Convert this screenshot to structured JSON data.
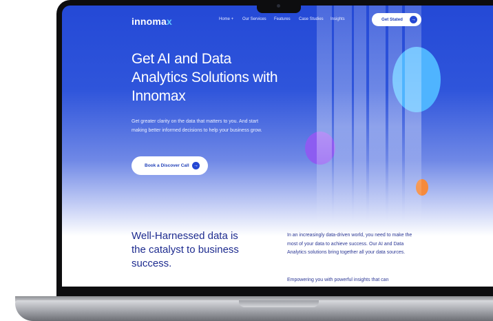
{
  "brand": {
    "logo_main": "innoma",
    "logo_accent": "x"
  },
  "nav": {
    "items": [
      {
        "label": "Home +"
      },
      {
        "label": "Our Services"
      },
      {
        "label": "Features"
      },
      {
        "label": "Case Studies"
      },
      {
        "label": "Insights"
      }
    ],
    "cta_label": "Get Stated",
    "cta_icon": "arrow-right-icon"
  },
  "hero": {
    "title": "Get AI and Data Analytics Solutions with Innomax",
    "subtitle": "Get greater clarity on the data that matters to you. And start making better informed decisions to help your business grow.",
    "cta_label": "Book a Discover Call",
    "cta_icon": "arrow-right-icon"
  },
  "section": {
    "title": "Well-Harnessed data is the catalyst to business success.",
    "body": "In an increasingly data-driven world, you need to make the most of your data to achieve success. Our AI and Data Analytics solutions bring together all your data sources.",
    "body2": "Empowering you with powerful insights that can"
  },
  "colors": {
    "primary": "#2447d3",
    "hero_blue": "#2449d6",
    "heading_navy": "#1d2b8f",
    "accent_cyan": "#5ec8ff",
    "accent_purple": "#8d5cf1",
    "accent_orange": "#f58a3c"
  }
}
